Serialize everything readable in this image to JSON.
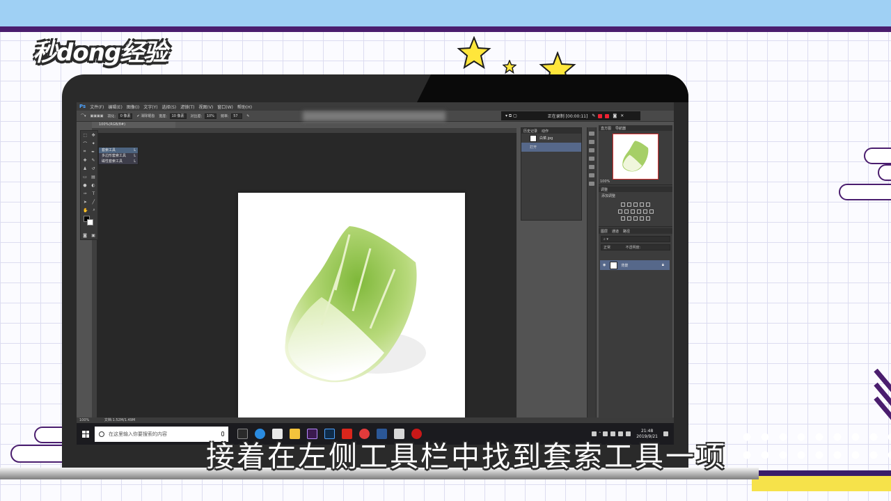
{
  "overlay": {
    "logo": "秒dong经验",
    "subtitle": "接着在左侧工具栏中找到套索工具一项"
  },
  "photoshop": {
    "app_label": "Ps",
    "menu": [
      "文件(F)",
      "编辑(E)",
      "图像(I)",
      "文字(Y)",
      "选择(S)",
      "滤镜(T)",
      "视图(V)",
      "窗口(W)",
      "帮助(H)"
    ],
    "options": {
      "feather_label": "羽化:",
      "feather_value": "0 像素",
      "antialias_label": "消除锯齿",
      "width_label": "宽度:",
      "width_value": "10 像素",
      "contrast_label": "对比度:",
      "contrast_value": "10%",
      "frequency_label": "频率:",
      "frequency_value": "57"
    },
    "recording": {
      "status": "正在录制 [00:00:11]"
    },
    "doc_tab": "100%(RGB/8#)",
    "status_zoom": "100%",
    "status_doc": "文档:1.52M/1.49M",
    "lasso_flyout": [
      {
        "label": "套索工具",
        "key": "L"
      },
      {
        "label": "多边形套索工具",
        "key": "L"
      },
      {
        "label": "磁性套索工具",
        "key": "L"
      }
    ],
    "history_panel": {
      "tabs": [
        "历史记录",
        "动作"
      ],
      "items": [
        "白菜.jpg",
        "打开"
      ]
    },
    "navigator_panel": {
      "tabs": [
        "直方图",
        "导航器"
      ],
      "zoom": "100%"
    },
    "adjustments_panel": {
      "tab": "调整",
      "label": "添加调整"
    },
    "layers_panel": {
      "tabs": [
        "图层",
        "通道",
        "路径"
      ],
      "blend_mode": "正常",
      "opacity_label": "不透明度:",
      "layer_name": "背景"
    }
  },
  "taskbar": {
    "search_placeholder": "在这里输入你要搜索的内容",
    "time": "21:48",
    "date": "2019/9/21"
  },
  "colors": {
    "ps_blue": "#4da3ff",
    "selection": "#56688a",
    "record_red": "#e22233",
    "subtitle_text": "#ffffff",
    "star_yellow": "#ffe63b"
  }
}
